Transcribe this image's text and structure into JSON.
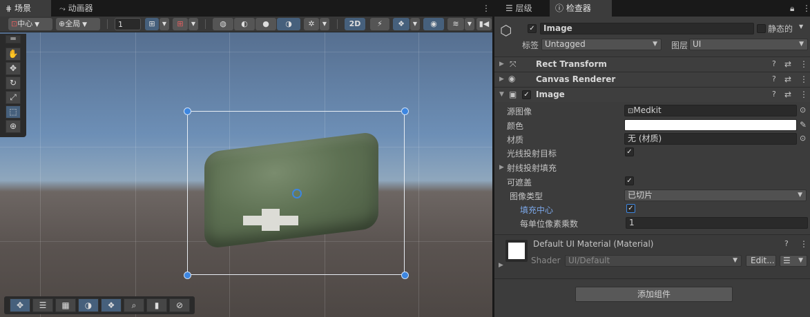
{
  "scene_tabs": {
    "scene": "场景",
    "animator": "动画器",
    "more": "⋮"
  },
  "toolbar": {
    "pivot_label": "中心",
    "space_label": "全局",
    "grid_value": "1",
    "mode_2d": "2D"
  },
  "inspector_tabs": {
    "hierarchy": "层级",
    "inspector": "检查器"
  },
  "object": {
    "name": "Image",
    "static_label": "静态的",
    "tag_label": "标签",
    "tag_value": "Untagged",
    "layer_label": "图层",
    "layer_value": "UI"
  },
  "components": [
    {
      "title": "Rect Transform"
    },
    {
      "title": "Canvas Renderer"
    },
    {
      "title": "Image"
    }
  ],
  "image_props": {
    "source_image_label": "源图像",
    "source_image_value": "Medkit",
    "color_label": "颜色",
    "color_value": "#ffffff",
    "material_label": "材质",
    "material_value": "无 (材质)",
    "raycast_target_label": "光线投射目标",
    "raycast_padding_label": "射线投射填充",
    "maskable_label": "可遮盖",
    "image_type_label": "图像类型",
    "image_type_value": "已切片",
    "fill_center_label": "填充中心",
    "ppu_label": "每单位像素乘数",
    "ppu_value": "1"
  },
  "material": {
    "title": "Default UI Material (Material)",
    "shader_label": "Shader",
    "shader_value": "UI/Default",
    "edit_button": "Edit..."
  },
  "add_component": "添加组件",
  "colors": {
    "accent": "#3d86e0",
    "panel": "#3c3c3c",
    "field": "#2a2a2a"
  }
}
